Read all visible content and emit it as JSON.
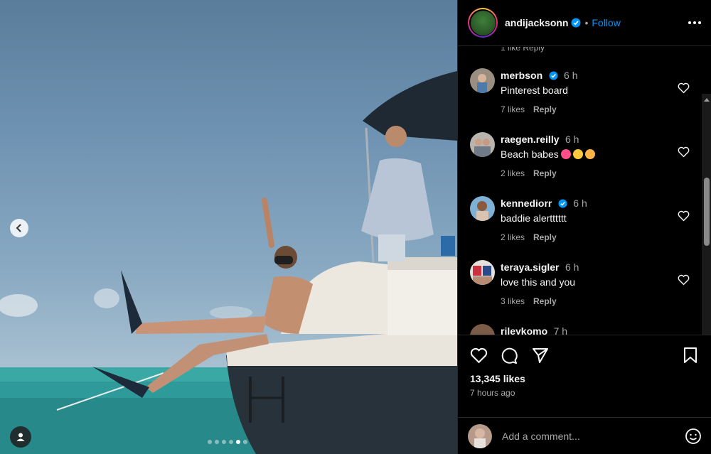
{
  "post": {
    "author": "andijacksonn",
    "follow_label": "Follow",
    "separator": "•",
    "likes": "13,345 likes",
    "time_ago": "7 hours ago",
    "carousel": {
      "total": 6,
      "active": 5
    }
  },
  "comments": {
    "cut_off_text": "1 like    Reply",
    "items": [
      {
        "user": "merbson",
        "verified": true,
        "time": "6 h",
        "text": "Pinterest board",
        "likes": "7 likes",
        "reply": "Reply"
      },
      {
        "user": "raegen.reilly",
        "verified": false,
        "time": "6 h",
        "text": "Beach babes",
        "likes": "2 likes",
        "reply": "Reply"
      },
      {
        "user": "kennediorr",
        "verified": true,
        "time": "6 h",
        "text": "baddie alertttttt",
        "likes": "2 likes",
        "reply": "Reply"
      },
      {
        "user": "teraya.sigler",
        "verified": false,
        "time": "6 h",
        "text": "love this and you",
        "likes": "3 likes",
        "reply": "Reply"
      },
      {
        "user": "rileykomo",
        "verified": false,
        "time": "7 h",
        "text": "",
        "likes": "",
        "reply": ""
      }
    ]
  },
  "composer": {
    "placeholder": "Add a comment..."
  },
  "icons": {
    "prev": "chevron-left-icon",
    "tag": "user-tag-icon",
    "more": "more-options-icon",
    "like": "heart-icon",
    "comment": "comment-icon",
    "share": "share-icon",
    "save": "bookmark-icon",
    "emoji": "emoji-icon"
  },
  "colors": {
    "accent": "#0095f6",
    "background": "#000000",
    "muted": "#a8a8a8"
  }
}
